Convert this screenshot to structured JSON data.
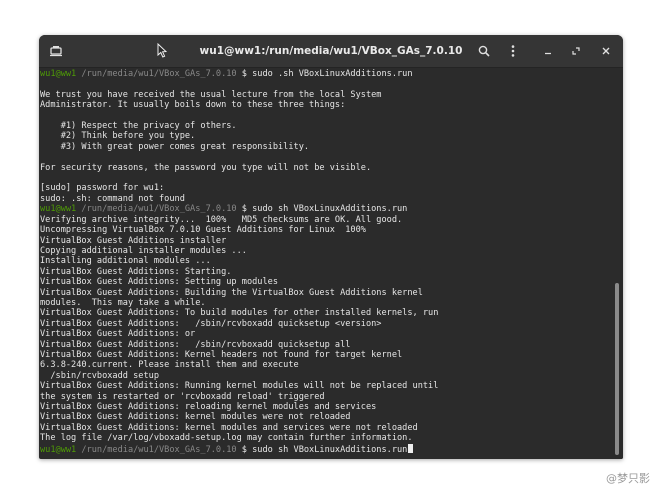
{
  "window": {
    "title": "wu1@ww1:/run/media/wu1/VBox_GAs_7.0.10"
  },
  "terminal": {
    "lines": [
      {
        "segments": [
          {
            "t": "wu1@ww1",
            "c": "u"
          },
          {
            "t": " /run/media/wu1/VBox_GAs_7.0.10",
            "c": "p"
          },
          {
            "t": " $ sudo .sh VBoxLinuxAdditions.run",
            "c": "w"
          }
        ]
      },
      {
        "segments": [
          {
            "t": "",
            "c": "w"
          }
        ]
      },
      {
        "segments": [
          {
            "t": "We trust you have received the usual lecture from the local System",
            "c": "w"
          }
        ]
      },
      {
        "segments": [
          {
            "t": "Administrator. It usually boils down to these three things:",
            "c": "w"
          }
        ]
      },
      {
        "segments": [
          {
            "t": "",
            "c": "w"
          }
        ]
      },
      {
        "segments": [
          {
            "t": "    #1) Respect the privacy of others.",
            "c": "w"
          }
        ]
      },
      {
        "segments": [
          {
            "t": "    #2) Think before you type.",
            "c": "w"
          }
        ]
      },
      {
        "segments": [
          {
            "t": "    #3) With great power comes great responsibility.",
            "c": "w"
          }
        ]
      },
      {
        "segments": [
          {
            "t": "",
            "c": "w"
          }
        ]
      },
      {
        "segments": [
          {
            "t": "For security reasons, the password you type will not be visible.",
            "c": "w"
          }
        ]
      },
      {
        "segments": [
          {
            "t": "",
            "c": "w"
          }
        ]
      },
      {
        "segments": [
          {
            "t": "[sudo] password for wu1:",
            "c": "w"
          }
        ]
      },
      {
        "segments": [
          {
            "t": "sudo: .sh: command not found",
            "c": "w"
          }
        ]
      },
      {
        "segments": [
          {
            "t": "wu1@ww1",
            "c": "u"
          },
          {
            "t": " /run/media/wu1/VBox_GAs_7.0.10",
            "c": "p"
          },
          {
            "t": " $ sudo sh VBoxLinuxAdditions.run",
            "c": "w"
          }
        ]
      },
      {
        "segments": [
          {
            "t": "Verifying archive integrity...  100%   MD5 checksums are OK. All good.",
            "c": "w"
          }
        ]
      },
      {
        "segments": [
          {
            "t": "Uncompressing VirtualBox 7.0.10 Guest Additions for Linux  100%",
            "c": "w"
          }
        ]
      },
      {
        "segments": [
          {
            "t": "VirtualBox Guest Additions installer",
            "c": "w"
          }
        ]
      },
      {
        "segments": [
          {
            "t": "Copying additional installer modules ...",
            "c": "w"
          }
        ]
      },
      {
        "segments": [
          {
            "t": "Installing additional modules ...",
            "c": "w"
          }
        ]
      },
      {
        "segments": [
          {
            "t": "VirtualBox Guest Additions: Starting.",
            "c": "w"
          }
        ]
      },
      {
        "segments": [
          {
            "t": "VirtualBox Guest Additions: Setting up modules",
            "c": "w"
          }
        ]
      },
      {
        "segments": [
          {
            "t": "VirtualBox Guest Additions: Building the VirtualBox Guest Additions kernel",
            "c": "w"
          }
        ]
      },
      {
        "segments": [
          {
            "t": "modules.  This may take a while.",
            "c": "w"
          }
        ]
      },
      {
        "segments": [
          {
            "t": "VirtualBox Guest Additions: To build modules for other installed kernels, run",
            "c": "w"
          }
        ]
      },
      {
        "segments": [
          {
            "t": "VirtualBox Guest Additions:   /sbin/rcvboxadd quicksetup <version>",
            "c": "w"
          }
        ]
      },
      {
        "segments": [
          {
            "t": "VirtualBox Guest Additions: or",
            "c": "w"
          }
        ]
      },
      {
        "segments": [
          {
            "t": "VirtualBox Guest Additions:   /sbin/rcvboxadd quicksetup all",
            "c": "w"
          }
        ]
      },
      {
        "segments": [
          {
            "t": "VirtualBox Guest Additions: Kernel headers not found for target kernel",
            "c": "w"
          }
        ]
      },
      {
        "segments": [
          {
            "t": "6.3.8-240.current. Please install them and execute",
            "c": "w"
          }
        ]
      },
      {
        "segments": [
          {
            "t": "  /sbin/rcvboxadd setup",
            "c": "w"
          }
        ]
      },
      {
        "segments": [
          {
            "t": "VirtualBox Guest Additions: Running kernel modules will not be replaced until",
            "c": "w"
          }
        ]
      },
      {
        "segments": [
          {
            "t": "the system is restarted or 'rcvboxadd reload' triggered",
            "c": "w"
          }
        ]
      },
      {
        "segments": [
          {
            "t": "VirtualBox Guest Additions: reloading kernel modules and services",
            "c": "w"
          }
        ]
      },
      {
        "segments": [
          {
            "t": "VirtualBox Guest Additions: kernel modules were not reloaded",
            "c": "w"
          }
        ]
      },
      {
        "segments": [
          {
            "t": "VirtualBox Guest Additions: kernel modules and services were not reloaded",
            "c": "w"
          }
        ]
      },
      {
        "segments": [
          {
            "t": "The log file /var/log/vboxadd-setup.log may contain further information.",
            "c": "w"
          }
        ]
      },
      {
        "segments": [
          {
            "t": "wu1@ww1",
            "c": "u"
          },
          {
            "t": " /run/media/wu1/VBox_GAs_7.0.10",
            "c": "p"
          },
          {
            "t": " $ sudo sh VBoxLinuxAdditions.run",
            "c": "w"
          }
        ],
        "cursor": true
      }
    ]
  },
  "scrollbar": {
    "thumb_start": 0.55,
    "thumb_end": 0.99
  },
  "watermark": {
    "text": "@梦只影"
  },
  "colors": {
    "terminal_bg": "#2b2b2b",
    "titlebar_bg": "#353535",
    "prompt_user": "#4e9a06",
    "prompt_path": "#888888",
    "text": "#e6e6e6"
  },
  "icons": {
    "new_tab": "new-tab-icon",
    "search": "search-icon",
    "menu": "kebab-menu-icon",
    "minimize": "minimize-icon",
    "maximize": "maximize-icon",
    "close": "close-icon",
    "cursor": "mouse-pointer-icon"
  }
}
